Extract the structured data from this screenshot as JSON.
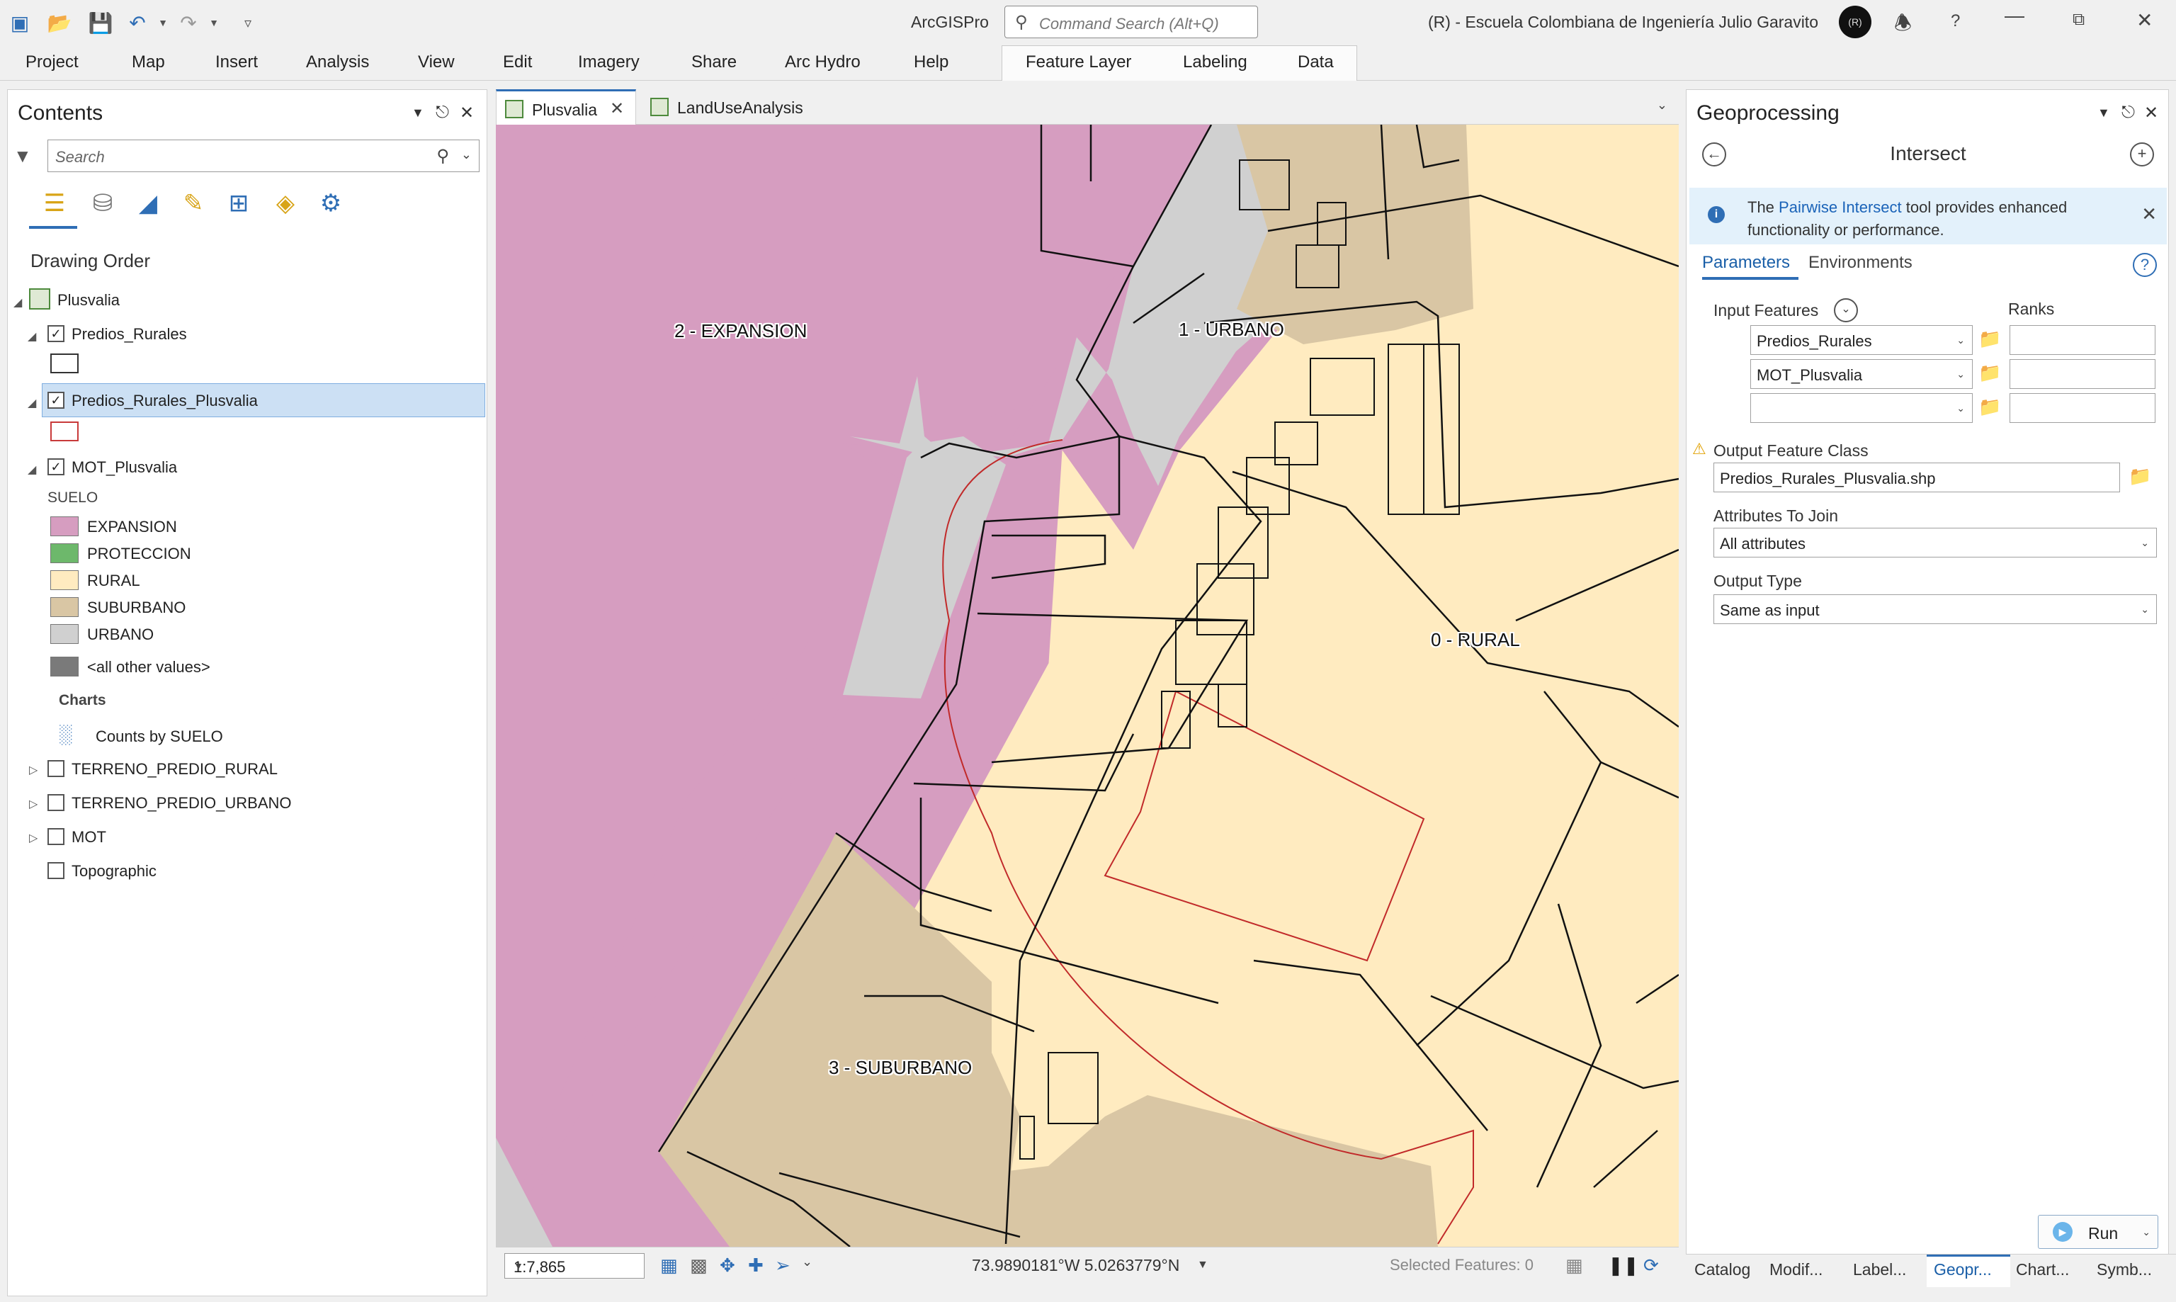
{
  "app": {
    "name": "ArcGISPro",
    "command_search_placeholder": "Command Search (Alt+Q)",
    "org": "(R) - Escuela Colombiana de Ingeniería Julio Garavito",
    "avatar_initials": "(R)"
  },
  "ribbon": {
    "tabs": [
      "Project",
      "Map",
      "Insert",
      "Analysis",
      "View",
      "Edit",
      "Imagery",
      "Share",
      "Arc Hydro",
      "Help"
    ],
    "context_tabs": [
      "Feature Layer",
      "Labeling",
      "Data"
    ]
  },
  "contents": {
    "title": "Contents",
    "search_placeholder": "Search",
    "drawing_order": "Drawing Order",
    "map_name": "Plusvalia",
    "layers": {
      "predios_rurales": "Predios_Rurales",
      "predios_rurales_plusvalia": "Predios_Rurales_Plusvalia",
      "mot_plusvalia": "MOT_Plusvalia",
      "suelo_heading": "SUELO",
      "charts_heading": "Charts",
      "chart_name": "Counts by SUELO",
      "terreno_rural": "TERRENO_PREDIO_RURAL",
      "terreno_urbano": "TERRENO_PREDIO_URBANO",
      "mot": "MOT",
      "topographic": "Topographic"
    },
    "legend": [
      {
        "label": "EXPANSION",
        "color": "#d69dc0"
      },
      {
        "label": "PROTECCION",
        "color": "#6db86b"
      },
      {
        "label": "RURAL",
        "color": "#ffebc0"
      },
      {
        "label": "SUBURBANO",
        "color": "#d9c6a4"
      },
      {
        "label": "URBANO",
        "color": "#d0d0d0"
      },
      {
        "label": "<all other values>",
        "color": "#7a7a7a"
      }
    ]
  },
  "map_tabs": {
    "active": "Plusvalia",
    "other": "LandUseAnalysis"
  },
  "map": {
    "labels": {
      "expansion": "2 - EXPANSION",
      "urbano": "1 - URBANO",
      "rural": "0 - RURAL",
      "suburbano": "3 - SUBURBANO"
    },
    "scale": "1:7,865",
    "coordinates": "73.9890181°W 5.0263779°N",
    "selected_features": "Selected Features: 0"
  },
  "geoprocessing": {
    "title": "Geoprocessing",
    "tool": "Intersect",
    "banner_prefix": "The ",
    "banner_link": "Pairwise Intersect",
    "banner_suffix": " tool provides enhanced functionality or performance.",
    "tabs": [
      "Parameters",
      "Environments"
    ],
    "input_features_label": "Input Features",
    "ranks_label": "Ranks",
    "inputs": [
      "Predios_Rurales",
      "MOT_Plusvalia",
      ""
    ],
    "output_label": "Output Feature Class",
    "output_value": "Predios_Rurales_Plusvalia.shp",
    "attributes_label": "Attributes To Join",
    "attributes_value": "All attributes",
    "output_type_label": "Output Type",
    "output_type_value": "Same as input",
    "run_label": "Run"
  },
  "bottom_tabs": [
    "Catalog",
    "Modif...",
    "Label...",
    "Geopr...",
    "Chart...",
    "Symb..."
  ]
}
